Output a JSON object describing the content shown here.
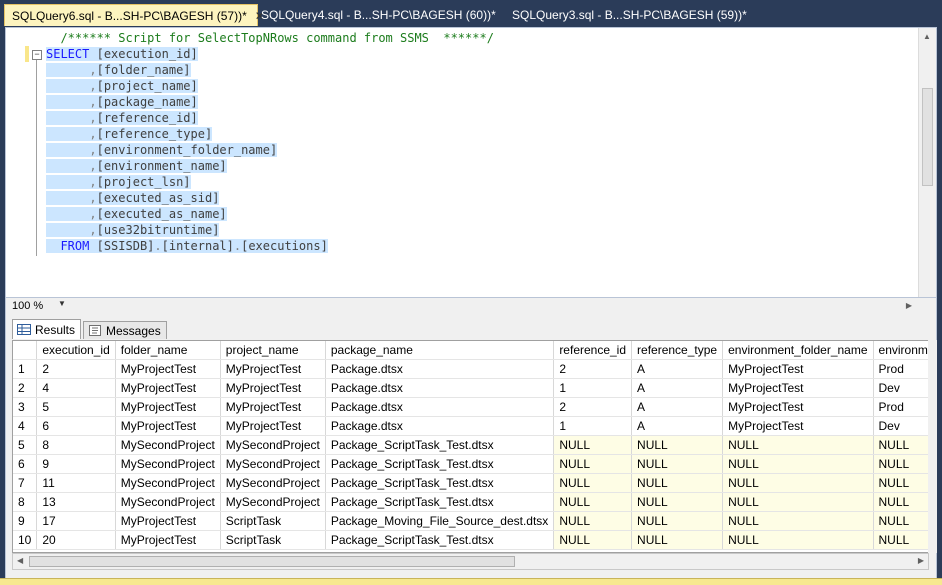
{
  "tabs": [
    {
      "label": "SQLQuery6.sql - B...SH-PC\\BAGESH (57))*",
      "close": "✕"
    },
    {
      "label": "SQLQuery4.sql - B...SH-PC\\BAGESH (60))*"
    },
    {
      "label": "SQLQuery3.sql - B...SH-PC\\BAGESH (59))*"
    }
  ],
  "editor": {
    "comment": "/****** Script for SelectTopNRows command from SSMS  ******/",
    "select_kw": "SELECT",
    "first_col": "[execution_id]",
    "columns": [
      "[folder_name]",
      "[project_name]",
      "[package_name]",
      "[reference_id]",
      "[reference_type]",
      "[environment_folder_name]",
      "[environment_name]",
      "[project_lsn]",
      "[executed_as_sid]",
      "[executed_as_name]",
      "[use32bitruntime]"
    ],
    "from_kw": "FROM",
    "table_parts": [
      "[SSISDB]",
      "[internal]",
      "[executions]"
    ]
  },
  "zoom": "100 %",
  "results_tabs": {
    "results": "Results",
    "messages": "Messages"
  },
  "grid": {
    "headers": [
      "execution_id",
      "folder_name",
      "project_name",
      "package_name",
      "reference_id",
      "reference_type",
      "environment_folder_name",
      "environment_n"
    ],
    "rows": [
      [
        "1",
        "2",
        "MyProjectTest",
        "MyProjectTest",
        "Package.dtsx",
        "2",
        "A",
        "MyProjectTest",
        "Prod"
      ],
      [
        "2",
        "4",
        "MyProjectTest",
        "MyProjectTest",
        "Package.dtsx",
        "1",
        "A",
        "MyProjectTest",
        "Dev"
      ],
      [
        "3",
        "5",
        "MyProjectTest",
        "MyProjectTest",
        "Package.dtsx",
        "2",
        "A",
        "MyProjectTest",
        "Prod"
      ],
      [
        "4",
        "6",
        "MyProjectTest",
        "MyProjectTest",
        "Package.dtsx",
        "1",
        "A",
        "MyProjectTest",
        "Dev"
      ],
      [
        "5",
        "8",
        "MySecondProject",
        "MySecondProject",
        "Package_ScriptTask_Test.dtsx",
        "NULL",
        "NULL",
        "NULL",
        "NULL"
      ],
      [
        "6",
        "9",
        "MySecondProject",
        "MySecondProject",
        "Package_ScriptTask_Test.dtsx",
        "NULL",
        "NULL",
        "NULL",
        "NULL"
      ],
      [
        "7",
        "11",
        "MySecondProject",
        "MySecondProject",
        "Package_ScriptTask_Test.dtsx",
        "NULL",
        "NULL",
        "NULL",
        "NULL"
      ],
      [
        "8",
        "13",
        "MySecondProject",
        "MySecondProject",
        "Package_ScriptTask_Test.dtsx",
        "NULL",
        "NULL",
        "NULL",
        "NULL"
      ],
      [
        "9",
        "17",
        "MyProjectTest",
        "ScriptTask",
        "Package_Moving_File_Source_dest.dtsx",
        "NULL",
        "NULL",
        "NULL",
        "NULL"
      ],
      [
        "10",
        "20",
        "MyProjectTest",
        "ScriptTask",
        "Package_ScriptTask_Test.dtsx",
        "NULL",
        "NULL",
        "NULL",
        "NULL"
      ]
    ]
  },
  "colors": {
    "accent": "#2b3c59",
    "selection": "#cce6ff",
    "null_cell": "#fefde5",
    "active_tab": "#fdf4bf"
  }
}
